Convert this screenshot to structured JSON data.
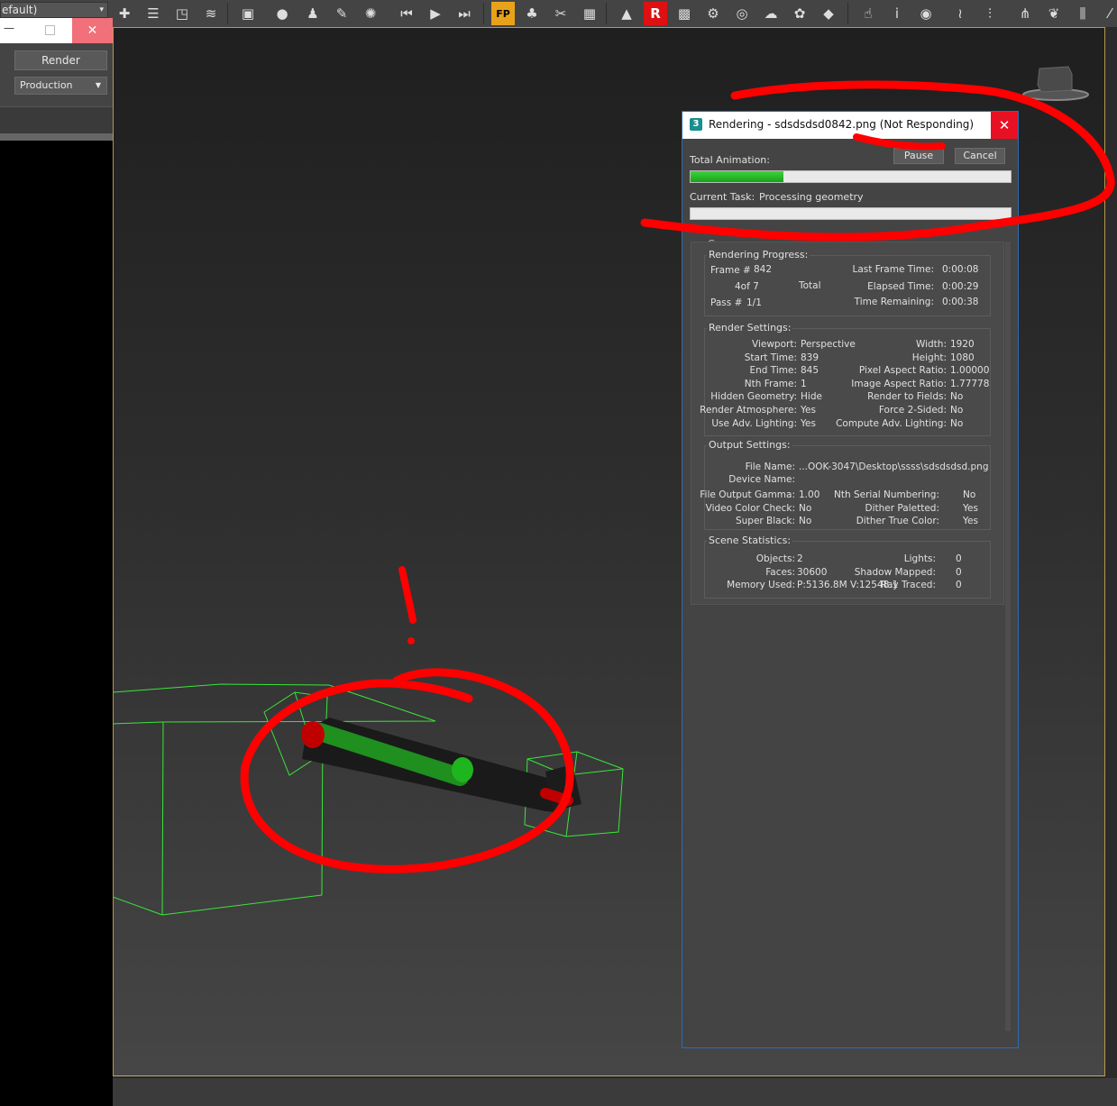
{
  "toolbar": {
    "scene_combo_value": "efault)",
    "buttons": [
      {
        "name": "select-and-link-icon",
        "glyph": "✚"
      },
      {
        "name": "layers-icon",
        "glyph": "☰"
      },
      {
        "name": "select-region-icon",
        "glyph": "◳"
      },
      {
        "name": "layer-stack-icon",
        "glyph": "≋"
      },
      {
        "name": "render-setup-icon",
        "glyph": "▣"
      },
      {
        "name": "sphere-icon",
        "glyph": "●"
      },
      {
        "name": "cloth-icon",
        "glyph": "♟"
      },
      {
        "name": "brush-icon",
        "glyph": "✎"
      },
      {
        "name": "particles-icon",
        "glyph": "✺"
      },
      {
        "name": "keyframe-icon",
        "glyph": "⏮"
      },
      {
        "name": "play-icon",
        "glyph": "▶"
      },
      {
        "name": "next-key-icon",
        "glyph": "⏭"
      },
      {
        "name": "fp-icon",
        "glyph": "FP"
      },
      {
        "name": "tree-icon",
        "glyph": "♣"
      },
      {
        "name": "tools-icon",
        "glyph": "✂"
      },
      {
        "name": "table-icon",
        "glyph": "▦"
      },
      {
        "name": "render-frame-icon",
        "glyph": "▲"
      },
      {
        "name": "render-r-icon",
        "glyph": "R"
      },
      {
        "name": "material-icon",
        "glyph": "▩"
      },
      {
        "name": "gear-icon",
        "glyph": "⚙"
      },
      {
        "name": "globe-icon",
        "glyph": "◎"
      },
      {
        "name": "cloud-icon",
        "glyph": "☁"
      },
      {
        "name": "grass-icon",
        "glyph": "✿"
      },
      {
        "name": "box-icon",
        "glyph": "◆"
      },
      {
        "name": "hand-icon",
        "glyph": "☝"
      },
      {
        "name": "info-icon",
        "glyph": "i"
      },
      {
        "name": "camera-icon",
        "glyph": "◉"
      },
      {
        "name": "hair-icon",
        "glyph": "≀"
      },
      {
        "name": "plants-icon",
        "glyph": "⫶"
      },
      {
        "name": "wheat-icon",
        "glyph": "⋔"
      },
      {
        "name": "fern-icon",
        "glyph": "❦"
      },
      {
        "name": "reeds-icon",
        "glyph": "⫼"
      },
      {
        "name": "wind-icon",
        "glyph": "⁄"
      }
    ]
  },
  "left_panel": {
    "render_label": "Render",
    "production_value": "Production"
  },
  "dialog": {
    "title": "Rendering - sdsdsdsd0842.png (Not Responding)",
    "pause_label": "Pause",
    "cancel_label": "Cancel",
    "total_animation_label": "Total Animation:",
    "total_progress": 0.29,
    "current_task_label": "Current Task:",
    "current_task_value": "Processing geometry",
    "current_progress": 0.0,
    "common_label": "Comm",
    "rendering_progress": {
      "title": "Rendering Progress:",
      "frame_label": "Frame #",
      "frame_value": "842",
      "count_value": "4of 7",
      "total_label": "Total",
      "pass_label": "Pass #",
      "pass_value": "1/1",
      "last_frame_time_label": "Last Frame Time:",
      "last_frame_time_value": "0:00:08",
      "elapsed_time_label": "Elapsed Time:",
      "elapsed_time_value": "0:00:29",
      "time_remaining_label": "Time Remaining:",
      "time_remaining_value": "0:00:38"
    },
    "render_settings": {
      "title": "Render Settings:",
      "left": [
        {
          "label": "Viewport:",
          "value": "Perspective"
        },
        {
          "label": "Start Time:",
          "value": "839"
        },
        {
          "label": "End Time:",
          "value": "845"
        },
        {
          "label": "Nth Frame:",
          "value": "1"
        },
        {
          "label": "Hidden Geometry:",
          "value": "Hide"
        },
        {
          "label": "Render Atmosphere:",
          "value": "Yes"
        },
        {
          "label": "Use Adv. Lighting:",
          "value": "Yes"
        }
      ],
      "right": [
        {
          "label": "Width:",
          "value": "1920"
        },
        {
          "label": "Height:",
          "value": "1080"
        },
        {
          "label": "Pixel Aspect Ratio:",
          "value": "1.00000"
        },
        {
          "label": "Image Aspect Ratio:",
          "value": "1.77778"
        },
        {
          "label": "Render to Fields:",
          "value": "No"
        },
        {
          "label": "Force 2-Sided:",
          "value": "No"
        },
        {
          "label": "Compute Adv. Lighting:",
          "value": "No"
        }
      ]
    },
    "output_settings": {
      "title": "Output Settings:",
      "file_name_label": "File Name:",
      "file_name_value": "...OOK-3047\\Desktop\\ssss\\sdsdsdsd.png",
      "device_name_label": "Device Name:",
      "left": [
        {
          "label": "File Output Gamma:",
          "value": "1.00"
        },
        {
          "label": "Video Color Check:",
          "value": "No"
        },
        {
          "label": "Super Black:",
          "value": "No"
        }
      ],
      "right": [
        {
          "label": "Nth Serial Numbering:",
          "value": "No"
        },
        {
          "label": "Dither Paletted:",
          "value": "Yes"
        },
        {
          "label": "Dither True Color:",
          "value": "Yes"
        }
      ]
    },
    "scene_statistics": {
      "title": "Scene Statistics:",
      "left": [
        {
          "label": "Objects:",
          "value": "2"
        },
        {
          "label": "Faces:",
          "value": "30600"
        },
        {
          "label": "Memory Used:",
          "value": "P:5136.8M V:12548.1"
        }
      ],
      "right": [
        {
          "label": "Lights:",
          "value": "0"
        },
        {
          "label": "Shadow Mapped:",
          "value": "0"
        },
        {
          "label": "Ray Traced:",
          "value": "0"
        }
      ]
    }
  },
  "colors": {
    "annotation_red": "#ff0000",
    "wireframe_green": "#39e639",
    "progress_green": "#1cb81c",
    "viewport_border": "#b59a48"
  }
}
